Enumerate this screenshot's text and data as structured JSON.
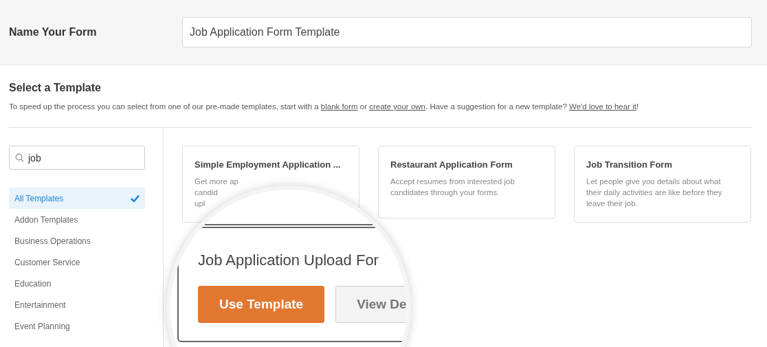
{
  "form_name": {
    "label": "Name Your Form",
    "value": "Job Application Form Template"
  },
  "section": {
    "title": "Select a Template",
    "description": [
      {
        "text": "To speed up the process you can select from one of our pre-made templates, start with a ",
        "link": false
      },
      {
        "text": "blank form",
        "link": true
      },
      {
        "text": " or ",
        "link": false
      },
      {
        "text": "create your own",
        "link": true
      },
      {
        "text": ". Have a suggestion for a new template? ",
        "link": false
      },
      {
        "text": "We'd love to hear it",
        "link": true
      },
      {
        "text": "!",
        "link": false
      }
    ]
  },
  "sidebar": {
    "search": {
      "value": "job"
    },
    "categories": [
      {
        "label": "All Templates",
        "selected": true
      },
      {
        "label": "Addon Templates",
        "selected": false
      },
      {
        "label": "Business Operations",
        "selected": false
      },
      {
        "label": "Customer Service",
        "selected": false
      },
      {
        "label": "Education",
        "selected": false
      },
      {
        "label": "Entertainment",
        "selected": false
      },
      {
        "label": "Event Planning",
        "selected": false
      }
    ]
  },
  "templates": [
    {
      "title": "Simple Employment Application ...",
      "lines": [
        "Get more ap",
        "candid",
        "upl"
      ]
    },
    {
      "title": "Restaurant Application Form",
      "lines": [
        "Accept resumes from interested job",
        "candidates through your forms."
      ]
    },
    {
      "title": "Job Transition Form",
      "lines": [
        "Let people give you details about what",
        "their daily activities are like before they",
        "leave their job."
      ]
    }
  ],
  "magnifier": {
    "card_title": "Job Application Upload For",
    "buttons": [
      {
        "label": "Use Template",
        "kind": "primary"
      },
      {
        "label": "View De",
        "kind": "secondary"
      }
    ]
  }
}
